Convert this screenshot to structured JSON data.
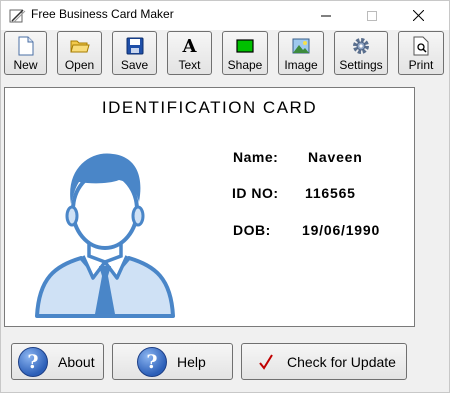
{
  "window": {
    "title": "Free Business Card Maker"
  },
  "toolbar": [
    {
      "label": "New",
      "icon": "new-file-icon"
    },
    {
      "label": "Open",
      "icon": "open-folder-icon"
    },
    {
      "label": "Save",
      "icon": "save-disk-icon"
    },
    {
      "label": "Text",
      "icon": "text-icon"
    },
    {
      "label": "Shape",
      "icon": "shape-icon"
    },
    {
      "label": "Image",
      "icon": "image-icon"
    },
    {
      "label": "Settings",
      "icon": "gear-icon"
    },
    {
      "label": "Print",
      "icon": "print-preview-icon"
    }
  ],
  "card": {
    "title": "IDENTIFICATION CARD",
    "fields": [
      {
        "label": "Name:",
        "value": "Naveen"
      },
      {
        "label": "ID NO:",
        "value": "116565"
      },
      {
        "label": "DOB:",
        "value": "19/06/1990"
      }
    ]
  },
  "bottom": {
    "about": "About",
    "help": "Help",
    "update": "Check for Update"
  },
  "colors": {
    "avatar": "#4a86c8",
    "avatar_fill": "#cfe1f5",
    "check": "#c00000"
  }
}
